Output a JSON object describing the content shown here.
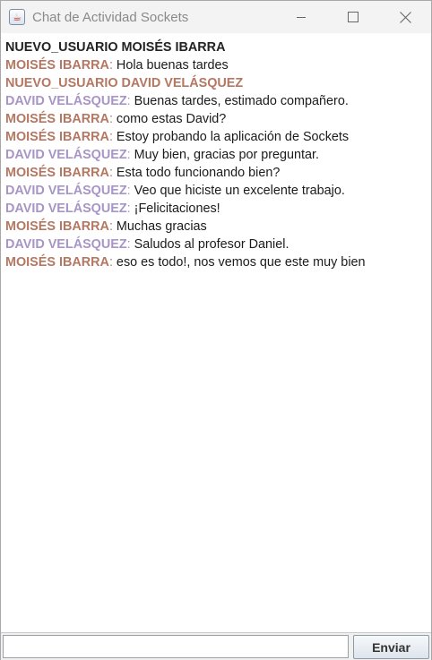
{
  "window": {
    "title": "Chat de Actividad Sockets",
    "icon": "java-cup-icon",
    "controls": [
      "minimize-icon",
      "maximize-icon",
      "close-icon"
    ]
  },
  "chat": {
    "lines": [
      {
        "type": "system",
        "text": "NUEVO_USUARIO MOISÉS IBARRA"
      },
      {
        "type": "message",
        "sender": "MOISÉS IBARRA",
        "sep": ":",
        "text": " Hola buenas tardes",
        "color": "#b47762"
      },
      {
        "type": "system-alt",
        "text": "NUEVO_USUARIO DAVID VELÁSQUEZ"
      },
      {
        "type": "message",
        "sender": "DAVID VELÁSQUEZ",
        "sep": ":",
        "text": " Buenas tardes, estimado compañero.",
        "color": "#a895c7"
      },
      {
        "type": "message",
        "sender": "MOISÉS IBARRA",
        "sep": ":",
        "text": " como estas David?",
        "color": "#b47762"
      },
      {
        "type": "message",
        "sender": "MOISÉS IBARRA",
        "sep": ":",
        "text": " Estoy probando la aplicación de Sockets",
        "color": "#b47762"
      },
      {
        "type": "message",
        "sender": "DAVID VELÁSQUEZ",
        "sep": ":",
        "text": " Muy bien, gracias por preguntar.",
        "color": "#a895c7"
      },
      {
        "type": "message",
        "sender": "MOISÉS IBARRA",
        "sep": ":",
        "text": " Esta todo funcionando bien?",
        "color": "#b47762"
      },
      {
        "type": "message",
        "sender": "DAVID VELÁSQUEZ",
        "sep": ":",
        "text": " Veo que hiciste un excelente trabajo.",
        "color": "#a895c7"
      },
      {
        "type": "message",
        "sender": "DAVID VELÁSQUEZ",
        "sep": ":",
        "text": " ¡Felicitaciones!",
        "color": "#a895c7"
      },
      {
        "type": "message",
        "sender": "MOISÉS IBARRA",
        "sep": ":",
        "text": " Muchas gracias",
        "color": "#b47762"
      },
      {
        "type": "message",
        "sender": "DAVID VELÁSQUEZ",
        "sep": ":",
        "text": " Saludos al profesor Daniel.",
        "color": "#a895c7"
      },
      {
        "type": "message",
        "sender": "MOISÉS IBARRA",
        "sep": ":",
        "text": " eso es todo!, nos vemos que este muy bien",
        "color": "#b47762"
      }
    ]
  },
  "composer": {
    "input_value": "",
    "send_label": "Enviar"
  }
}
